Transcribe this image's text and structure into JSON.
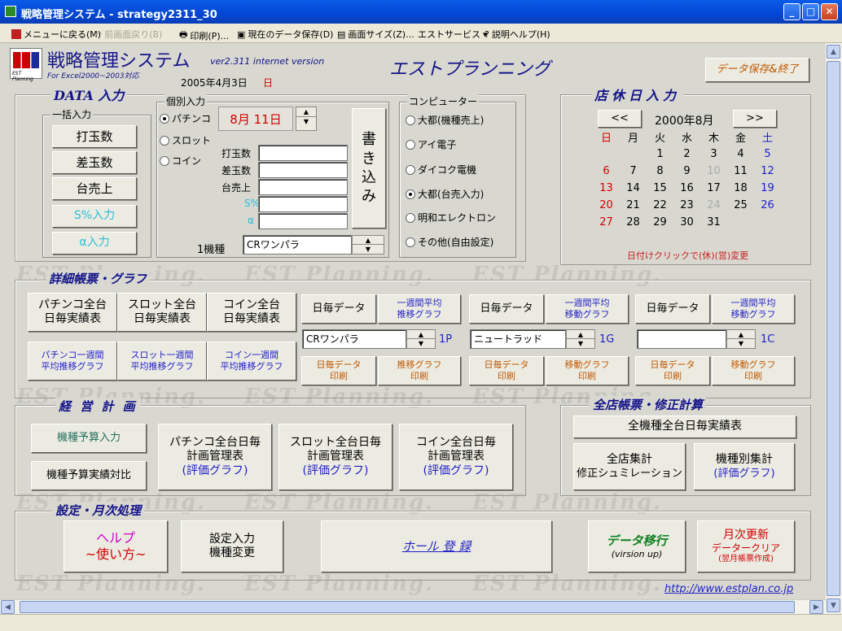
{
  "window": {
    "title": "戦略管理システム - strategy2311_30"
  },
  "menu": [
    {
      "label": "メニューに戻る(M)",
      "enabled": true
    },
    {
      "label": "前画面戻り(B)",
      "enabled": false
    },
    {
      "label": "印刷(P)...",
      "enabled": true
    },
    {
      "label": "現在のデータ保存(D)",
      "enabled": true
    },
    {
      "label": "画面サイズ(Z)...",
      "enabled": true
    },
    {
      "label": "エストサービス",
      "enabled": true
    },
    {
      "label": "説明ヘルプ(H)",
      "enabled": true
    }
  ],
  "header": {
    "app_name": "戦略管理システム",
    "version": "ver2.311 internet version",
    "excel_note": "For Excel2000~2003対応",
    "date": "2005年4月3日",
    "day": "日",
    "company": "エストプランニング",
    "save_exit": "データ保存&終了",
    "logo_caption": "EST Planning"
  },
  "watermark": "EST Planning.",
  "data_input": {
    "title": "DATA 入力",
    "bulk": {
      "label": "一括入力",
      "buttons": [
        "打玉数",
        "差玉数",
        "台売上",
        "S%入力",
        "α入力"
      ]
    },
    "individual": {
      "label": "個別入力",
      "types": [
        "パチンコ",
        "スロット",
        "コイン"
      ],
      "selected": "パチンコ",
      "date": "8月 11日",
      "fields": [
        "打玉数",
        "差玉数",
        "台売上",
        "S%",
        "α"
      ],
      "model_label": "1機種",
      "model_value": "CRワンパラ",
      "write_button": "書き込み"
    },
    "computer": {
      "label": "コンピューター",
      "options": [
        "大都(機種売上)",
        "アイ電子",
        "ダイコク電機",
        "大都(台売入力)",
        "明和エレクトロン",
        "その他(自由設定)"
      ],
      "selected": "大都(台売入力)"
    }
  },
  "holiday": {
    "title": "店休日入力",
    "prev": "<<",
    "next": ">>",
    "month_label": "2000年8月",
    "weekdays": [
      "日",
      "月",
      "火",
      "水",
      "木",
      "金",
      "土"
    ],
    "weeks": [
      [
        "",
        "",
        "1",
        "2",
        "3",
        "4",
        "5"
      ],
      [
        "6",
        "7",
        "8",
        "9",
        "10",
        "11",
        "12"
      ],
      [
        "13",
        "14",
        "15",
        "16",
        "17",
        "18",
        "19"
      ],
      [
        "20",
        "21",
        "22",
        "23",
        "24",
        "25",
        "26"
      ],
      [
        "27",
        "28",
        "29",
        "30",
        "31",
        "",
        ""
      ]
    ],
    "note": "日付けクリックで(休)(営)変更"
  },
  "reports": {
    "title": "詳細帳票・グラフ",
    "daily": [
      "パチンコ全台\n日毎実績表",
      "スロット全台\n日毎実績表",
      "コイン全台\n日毎実績表"
    ],
    "weekly": [
      "パチンコ一週間\n平均推移グラフ",
      "スロット一週間\n平均推移グラフ",
      "コイン一週間\n平均推移グラフ"
    ],
    "groups": [
      {
        "daily_label": "日毎データ",
        "weekly_label": "一週間平均\n推移グラフ",
        "model": "CRワンパラ",
        "suffix": "1P",
        "print1": "日毎データ\n印刷",
        "print2": "推移グラフ\n印刷"
      },
      {
        "daily_label": "日毎データ",
        "weekly_label": "一週間平均\n移動グラフ",
        "model": "ニュートラッド",
        "suffix": "1G",
        "print1": "日毎データ\n印刷",
        "print2": "移動グラフ\n印刷"
      },
      {
        "daily_label": "日毎データ",
        "weekly_label": "一週間平均\n移動グラフ",
        "model": "",
        "suffix": "1C",
        "print1": "日毎データ\n印刷",
        "print2": "移動グラフ\n印刷"
      }
    ]
  },
  "plan": {
    "title": "経 営 計 画",
    "budget_input": "機種予算入力",
    "budget_compare": "機種予算実績対比",
    "tables": [
      {
        "line1": "パチンコ全台日毎",
        "line2": "計画管理表",
        "line3": "(評価グラフ)"
      },
      {
        "line1": "スロット全台日毎",
        "line2": "計画管理表",
        "line3": "(評価グラフ)"
      },
      {
        "line1": "コイン全台日毎",
        "line2": "計画管理表",
        "line3": "(評価グラフ)"
      }
    ]
  },
  "store": {
    "title": "全店帳票・修正計算",
    "all_models": "全機種全台日毎実績表",
    "store_total_1": "全店集計",
    "store_total_2": "修正シュミレーション",
    "model_total_1": "機種別集計",
    "model_total_2": "(評価グラフ)"
  },
  "settings": {
    "title": "設定・月次処理",
    "help_1": "ヘルプ",
    "help_2": "~使い方~",
    "setup_1": "設定入力",
    "setup_2": "機種変更",
    "hall": "ホール 登 録",
    "migrate_1": "データ移行",
    "migrate_2": "(virsion up)",
    "monthly_1": "月次更新",
    "monthly_2": "データークリア",
    "monthly_3": "(翌月帳票作成)"
  },
  "footer": {
    "url": "http://www.estplan.co.jp"
  }
}
